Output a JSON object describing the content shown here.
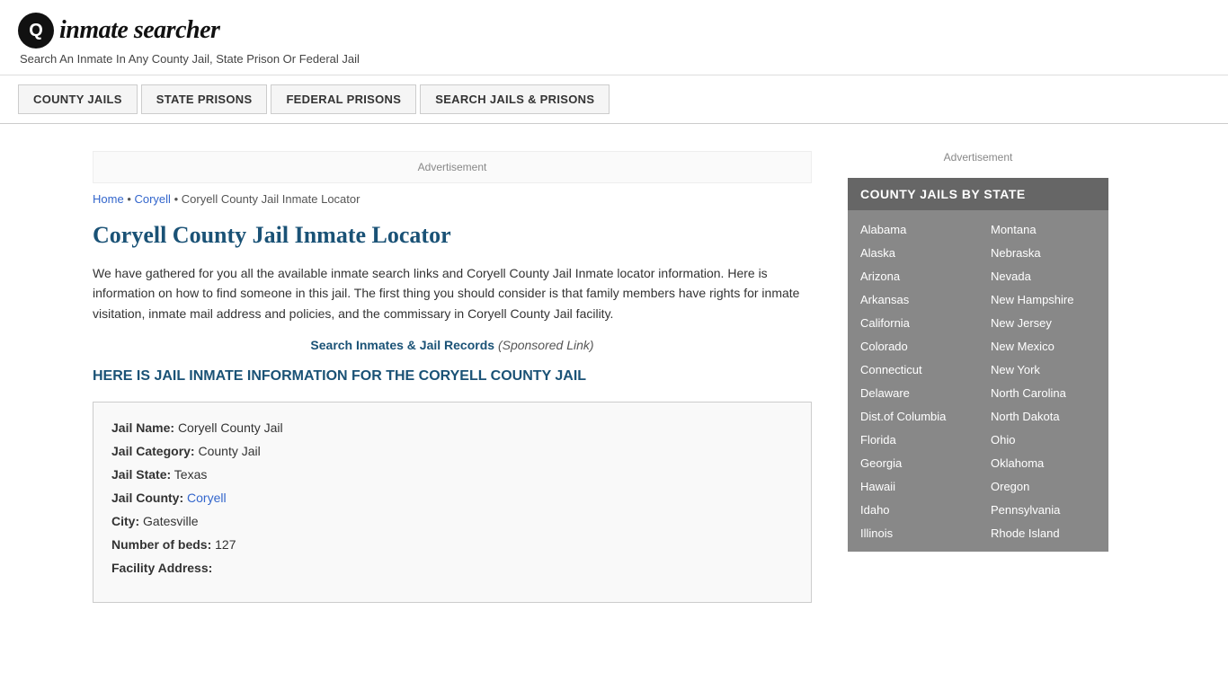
{
  "logo": {
    "icon_symbol": "Q",
    "text_part1": "inmate",
    "text_part2": "searcher",
    "tagline": "Search An Inmate In Any County Jail, State Prison Or Federal Jail"
  },
  "nav": {
    "items": [
      {
        "label": "COUNTY JAILS",
        "href": "#",
        "active": true
      },
      {
        "label": "STATE PRISONS",
        "href": "#"
      },
      {
        "label": "FEDERAL PRISONS",
        "href": "#"
      },
      {
        "label": "SEARCH JAILS & PRISONS",
        "href": "#"
      }
    ]
  },
  "ad_label": "Advertisement",
  "breadcrumb": {
    "home": "Home",
    "parent": "Coryell",
    "current": "Coryell County Jail Inmate Locator"
  },
  "page_title": "Coryell County Jail Inmate Locator",
  "description": "We have gathered for you all the available inmate search links and Coryell County Jail Inmate locator information. Here is information on how to find someone in this jail. The first thing you should consider is that family members have rights for inmate visitation, inmate mail address and policies, and the commissary in Coryell County Jail facility.",
  "search_link": {
    "text": "Search Inmates & Jail Records",
    "sponsored": "(Sponsored Link)"
  },
  "jail_info_heading": "HERE IS JAIL INMATE INFORMATION FOR THE CORYELL COUNTY JAIL",
  "jail_info": {
    "name_label": "Jail Name:",
    "name_value": "Coryell County Jail",
    "category_label": "Jail Category:",
    "category_value": "County Jail",
    "state_label": "Jail State:",
    "state_value": "Texas",
    "county_label": "Jail County:",
    "county_value": "Coryell",
    "city_label": "City:",
    "city_value": "Gatesville",
    "beds_label": "Number of beds:",
    "beds_value": "127",
    "address_label": "Facility Address:"
  },
  "sidebar": {
    "ad_label": "Advertisement",
    "section_title": "COUNTY JAILS BY STATE",
    "states_left": [
      "Alabama",
      "Alaska",
      "Arizona",
      "Arkansas",
      "California",
      "Colorado",
      "Connecticut",
      "Delaware",
      "Dist.of Columbia",
      "Florida",
      "Georgia",
      "Hawaii",
      "Idaho",
      "Illinois"
    ],
    "states_right": [
      "Montana",
      "Nebraska",
      "Nevada",
      "New Hampshire",
      "New Jersey",
      "New Mexico",
      "New York",
      "North Carolina",
      "North Dakota",
      "Ohio",
      "Oklahoma",
      "Oregon",
      "Pennsylvania",
      "Rhode Island"
    ]
  }
}
